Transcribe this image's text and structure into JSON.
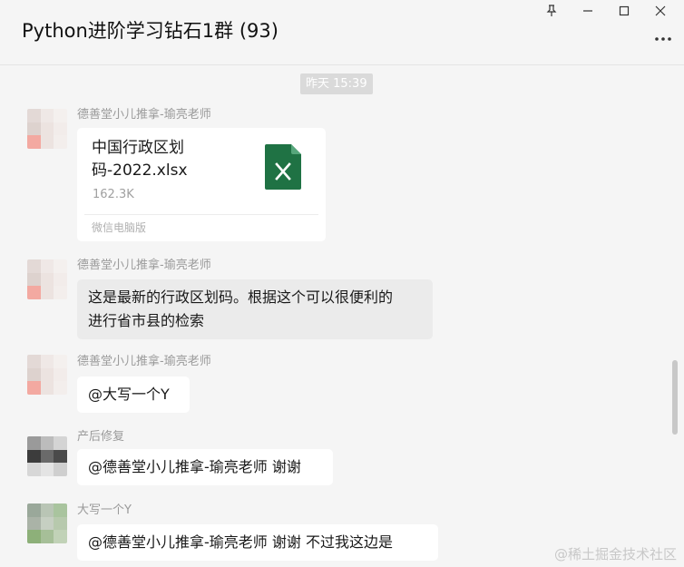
{
  "window": {
    "title": "Python进阶学习钻石1群 (93)",
    "pin_icon": "pin-icon",
    "minimize_icon": "minimize-icon",
    "maximize_icon": "maximize-icon",
    "close_icon": "close-icon",
    "more_icon": "more-icon"
  },
  "chat": {
    "timestamp": "昨天 15:39",
    "messages": [
      {
        "sender": "德善堂小儿推拿-瑜亮老师",
        "type": "file",
        "file_name": "中国行政区划码-2022.xlsx",
        "file_name_line1": "中国行政区划",
        "file_name_line2": "码-2022.xlsx",
        "file_size": "162.3K",
        "file_source": "微信电脑版",
        "file_icon": "excel-file-icon"
      },
      {
        "sender": "德善堂小儿推拿-瑜亮老师",
        "type": "text",
        "line1": "这是最新的行政区划码。根据这个可以很便利的",
        "line2": "进行省市县的检索"
      },
      {
        "sender": "德善堂小儿推拿-瑜亮老师",
        "type": "text",
        "line1": "@大写一个Y"
      },
      {
        "sender": "产后修复",
        "type": "text",
        "line1": "@德善堂小儿推拿-瑜亮老师 谢谢"
      },
      {
        "sender": "大写一个Y",
        "type": "text",
        "line1": "@德善堂小儿推拿-瑜亮老师 谢谢  不过我这边是"
      }
    ]
  },
  "watermark": "@稀土掘金技术社区",
  "colors": {
    "background": "#f5f5f5",
    "bubble": "#ffffff",
    "bubble_highlight": "#ebebeb",
    "excel_green": "#1f7244"
  }
}
